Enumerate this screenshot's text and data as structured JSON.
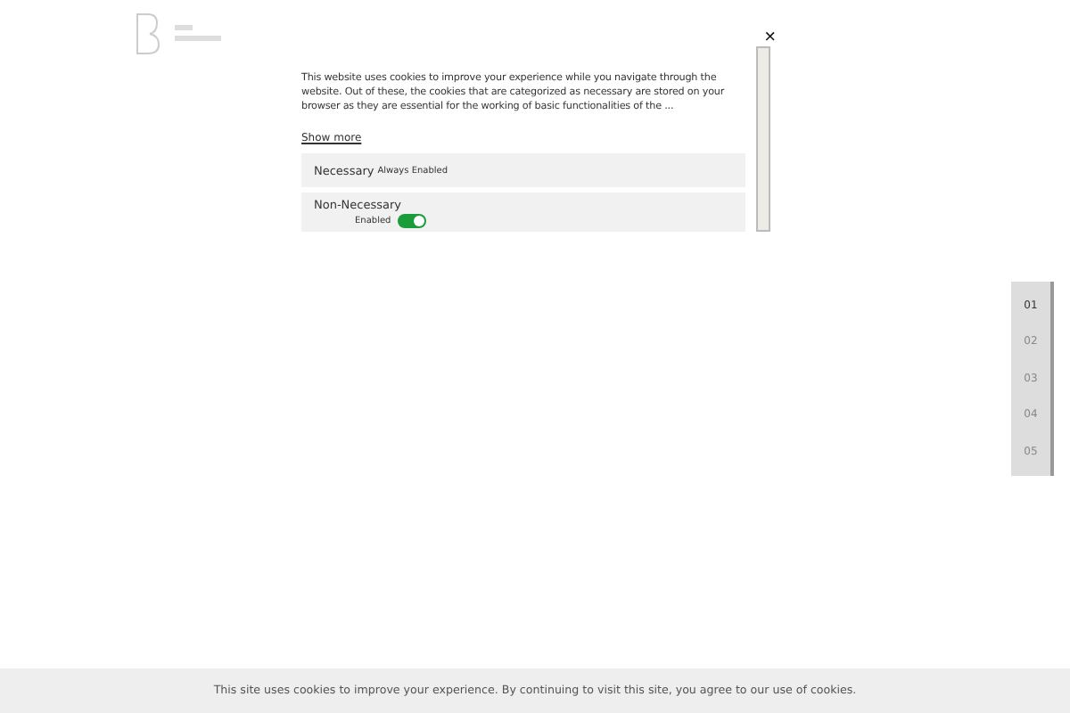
{
  "cookie_dialog": {
    "close": "×",
    "text": "This website uses cookies to improve your experience while you navigate through the website. Out of these, the cookies that are categorized as necessary are stored on your browser as they are essential for the working of basic functionalities of the ...",
    "show_more": "Show more",
    "categories": [
      {
        "kind": "fixed",
        "name": "Necessary",
        "status": "Always Enabled"
      },
      {
        "kind": "toggle",
        "name": "Non-Necessary",
        "status": "Enabled",
        "on": true
      }
    ]
  },
  "section_nav": [
    {
      "label": "01",
      "selected": true
    },
    {
      "label": "02",
      "selected": false
    },
    {
      "label": "03",
      "selected": false
    },
    {
      "label": "04",
      "selected": false
    },
    {
      "label": "05",
      "selected": false
    }
  ],
  "cookie_bar": {
    "text": "This site uses cookies to improve your experience. By continuing to visit this site, you agree to our use of cookies."
  }
}
